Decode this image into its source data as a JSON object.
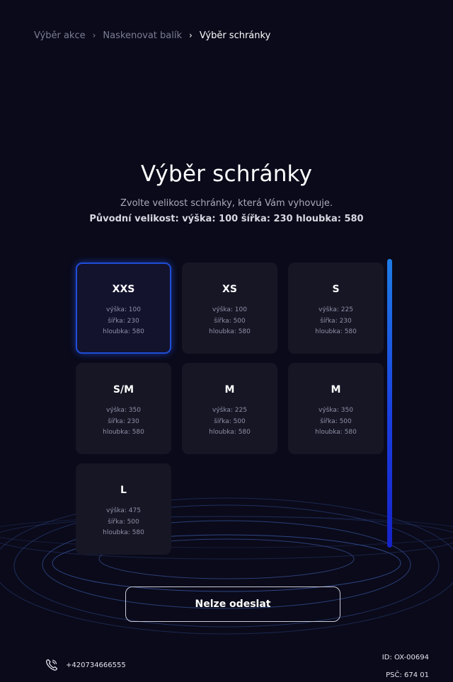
{
  "breadcrumb": {
    "items": [
      "Výběr akce",
      "Naskenovat balík",
      "Výběr schránky"
    ],
    "separator": "›"
  },
  "header": {
    "title": "Výběr schránky",
    "subtitle": "Zvolte velikost schránky, která Vám vyhovuje.",
    "original_size": "Původní velikost: výška: 100 šířka: 230 hloubka: 580"
  },
  "boxes": [
    {
      "size": "XXS",
      "height": "výška: 100",
      "width": "šířka: 230",
      "depth": "hloubka: 580",
      "selected": true
    },
    {
      "size": "XS",
      "height": "výška: 100",
      "width": "šířka: 500",
      "depth": "hloubka: 580",
      "selected": false
    },
    {
      "size": "S",
      "height": "výška: 225",
      "width": "šířka: 230",
      "depth": "hloubka: 580",
      "selected": false
    },
    {
      "size": "S/M",
      "height": "výška: 350",
      "width": "šířka: 230",
      "depth": "hloubka: 580",
      "selected": false
    },
    {
      "size": "M",
      "height": "výška: 225",
      "width": "šířka: 500",
      "depth": "hloubka: 580",
      "selected": false
    },
    {
      "size": "M",
      "height": "výška: 350",
      "width": "šířka: 500",
      "depth": "hloubka: 580",
      "selected": false
    },
    {
      "size": "L",
      "height": "výška: 475",
      "width": "šířka: 500",
      "depth": "hloubka: 580",
      "selected": false
    }
  ],
  "actions": {
    "send_label": "Nelze odeslat"
  },
  "footer": {
    "phone_icon": "phone-icon",
    "phone": "+420734666555",
    "device_id": "ID: OX-00694",
    "postal_code": "PSČ: 674 01"
  },
  "colors": {
    "background": "#0a0a1a",
    "card": "#161625",
    "accent": "#1f4ed8",
    "scrollbar_top": "#1e7ce6",
    "scrollbar_bottom": "#1622c8"
  }
}
